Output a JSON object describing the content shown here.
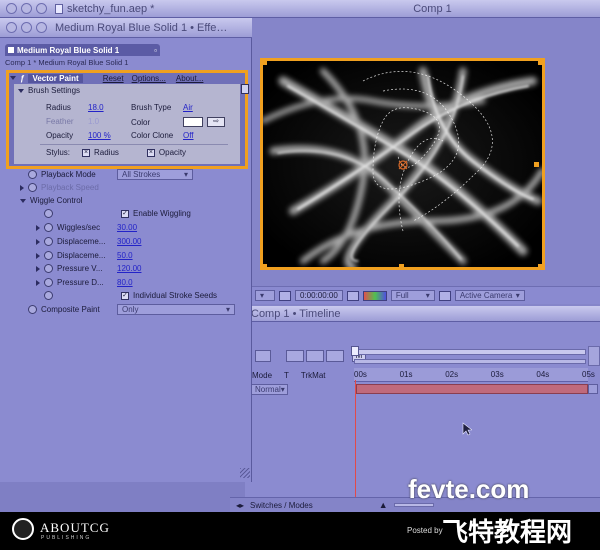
{
  "project_window": {
    "title": "sketchy_fun.aep *"
  },
  "effect_controls": {
    "title": "Medium Royal Blue Solid 1 • Effe…",
    "tab": "Medium Royal Blue Solid 1",
    "breadcrumb": "Comp 1 * Medium Royal Blue Solid 1",
    "effect_name": "Vector Paint",
    "reset_label": "Reset",
    "options_label": "Options...",
    "about_label": "About...",
    "brush_settings": {
      "label": "Brush Settings",
      "radius_label": "Radius",
      "radius_value": "18.0",
      "feather_label": "Feather",
      "feather_value": "1.0",
      "opacity_label": "Opacity",
      "opacity_value": "100 %",
      "brush_type_label": "Brush Type",
      "brush_type_value": "Air",
      "color_label": "Color",
      "color_swatch": "#ffffff",
      "color_clone_label": "Color Clone",
      "color_clone_value": "Off",
      "stylus_label": "Stylus:",
      "stylus_radius": "Radius",
      "stylus_opacity": "Opacity"
    },
    "playback_mode_label": "Playback Mode",
    "playback_mode_value": "All Strokes",
    "playback_speed_label": "Playback Speed",
    "wiggle_control_label": "Wiggle Control",
    "enable_wiggling_label": "Enable Wiggling",
    "wiggle_rows": [
      {
        "label": "Wiggles/sec",
        "value": "30.00"
      },
      {
        "label": "Displaceme...",
        "value": "300.00"
      },
      {
        "label": "Displaceme...",
        "value": "50.0"
      },
      {
        "label": "Pressure V...",
        "value": "120.00"
      },
      {
        "label": "Pressure D...",
        "value": "80.0"
      }
    ],
    "individual_stroke_seeds_label": "Individual Stroke Seeds",
    "composite_paint_label": "Composite Paint",
    "composite_paint_value": "Only"
  },
  "comp_window": {
    "title": "Comp 1",
    "timecode": "0:00:00:00",
    "resolution": "Full",
    "camera": "Active Camera",
    "highlight_color": "#f0a020"
  },
  "timeline": {
    "title": "Comp 1 • Timeline",
    "mode_label": "Mode",
    "t_label": "T",
    "trkmat_label": "TrkMat",
    "mode_value": "Normal",
    "ruler_ticks": [
      "00s",
      "01s",
      "02s",
      "03s",
      "04s",
      "05s"
    ],
    "switches_modes": "Switches / Modes"
  },
  "footer": {
    "brand": "ABOUTCG",
    "brand_sub": "PUBLISHING",
    "posted_by": "Posted by",
    "watermark_top": "fevte.com",
    "watermark_cn": "飞特教程网"
  }
}
